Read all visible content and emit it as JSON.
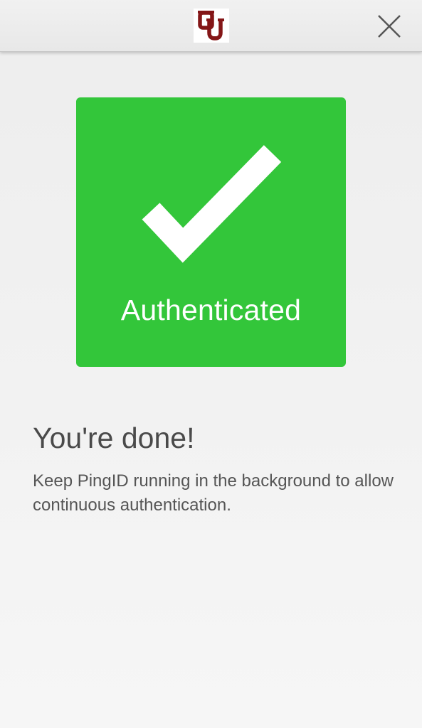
{
  "header": {
    "logo_icon": "ou-logo-icon",
    "logo_color": "#841617",
    "close_icon": "close-icon"
  },
  "status_card": {
    "label": "Authenticated",
    "icon": "checkmark-icon",
    "color": "#33c63a"
  },
  "content": {
    "title": "You're done!",
    "description": "Keep PingID running in the background to allow continuous authentication."
  }
}
